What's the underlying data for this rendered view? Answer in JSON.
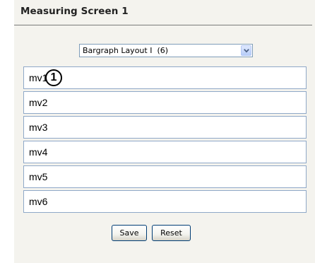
{
  "header": {
    "title": "Measuring Screen 1"
  },
  "layout_select": {
    "value": "Bargraph Layout I  (6)",
    "icon": "chevron-down-icon"
  },
  "rows": [
    {
      "label": "mv1",
      "marker": "1"
    },
    {
      "label": "mv2"
    },
    {
      "label": "mv3"
    },
    {
      "label": "mv4"
    },
    {
      "label": "mv5"
    },
    {
      "label": "mv6"
    }
  ],
  "buttons": {
    "save_label": "Save",
    "reset_label": "Reset"
  },
  "colors": {
    "panel_background": "#f4f3ee",
    "row_border": "#8fa8c8",
    "button_border": "#003c74"
  }
}
